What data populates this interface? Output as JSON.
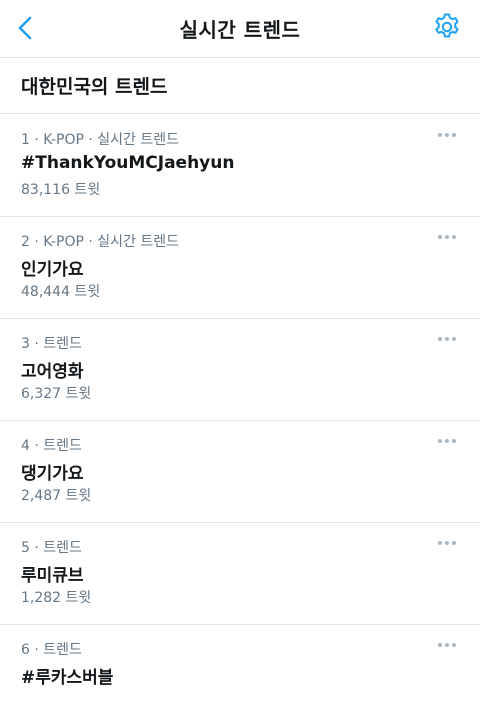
{
  "nav": {
    "title": "실시간 트렌드",
    "back_icon": "chevron-left-icon",
    "settings_icon": "gear-icon",
    "accent_color": "#1da1f2"
  },
  "section": {
    "title": "대한민국의 트렌드"
  },
  "trends": [
    {
      "meta": "1 · K-POP · 실시간 트렌드",
      "name": "#ThankYouMCJaehyun",
      "count": "83,116 트윗"
    },
    {
      "meta": "2 · K-POP · 실시간 트렌드",
      "name": "인기가요",
      "count": "48,444 트윗"
    },
    {
      "meta": "3 · 트렌드",
      "name": "고어영화",
      "count": "6,327 트윗"
    },
    {
      "meta": "4 · 트렌드",
      "name": "댕기가요",
      "count": "2,487 트윗"
    },
    {
      "meta": "5 · 트렌드",
      "name": "루미큐브",
      "count": "1,282 트윗"
    },
    {
      "meta": "6 · 트렌드",
      "name": "#루카스버블",
      "count": ""
    }
  ]
}
